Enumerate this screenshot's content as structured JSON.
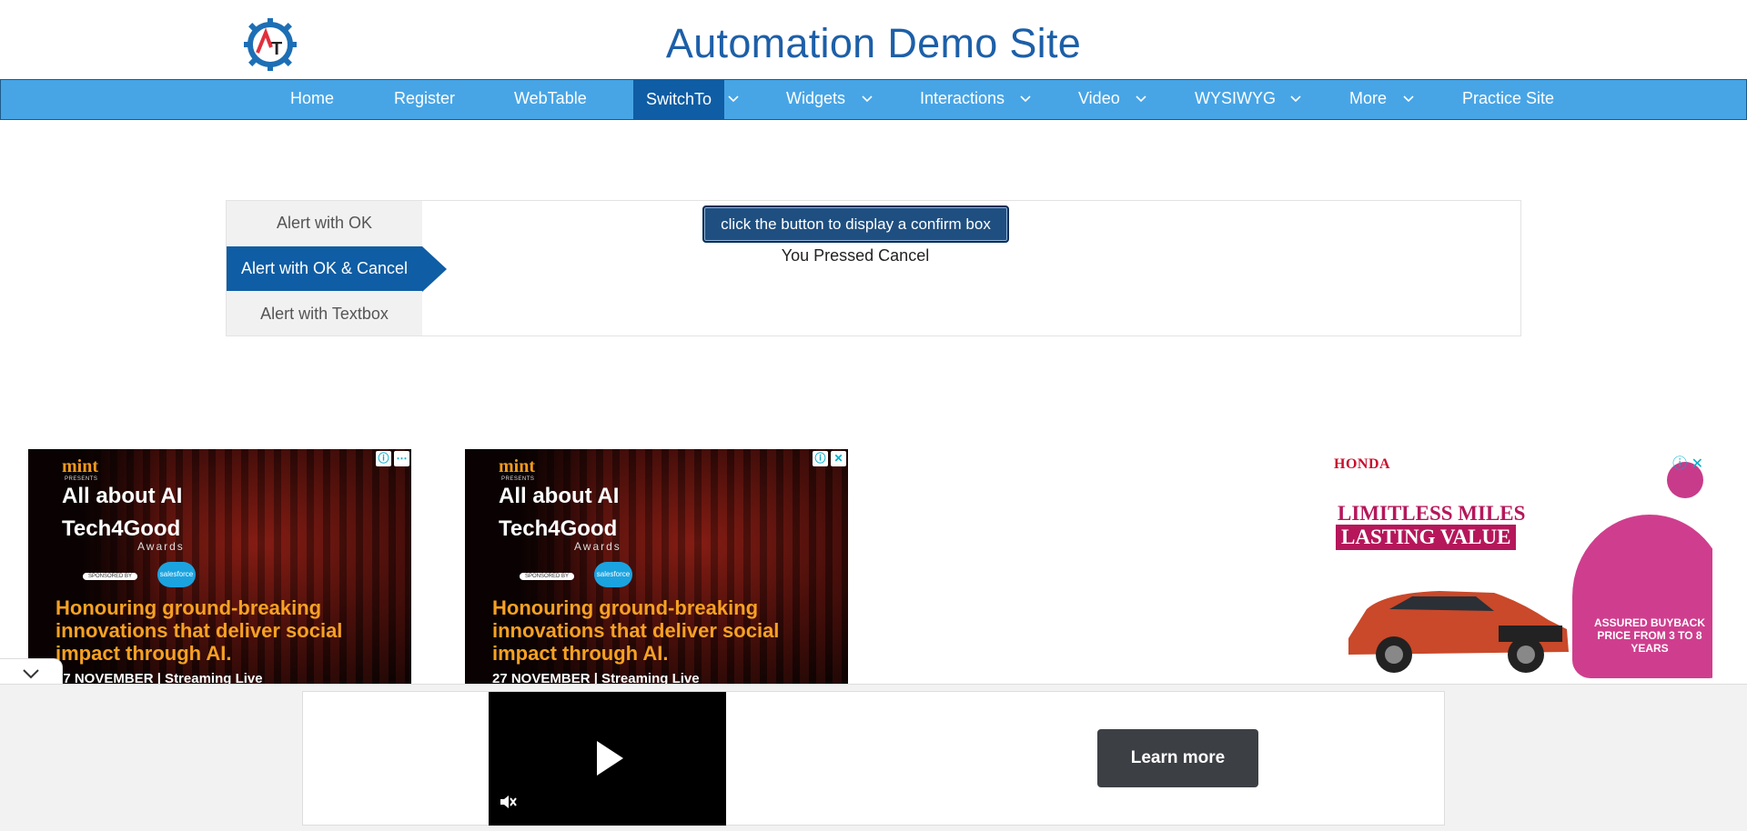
{
  "header": {
    "title": "Automation Demo Site",
    "logo_text": "AT"
  },
  "nav": {
    "items": [
      {
        "label": "Home"
      },
      {
        "label": "Register"
      },
      {
        "label": "WebTable"
      },
      {
        "label": "SwitchTo",
        "active": true
      },
      {
        "label": "Widgets"
      },
      {
        "label": "Interactions"
      },
      {
        "label": "Video"
      },
      {
        "label": "WYSIWYG"
      },
      {
        "label": "More"
      },
      {
        "label": "Practice Site"
      }
    ]
  },
  "tabs": [
    {
      "label": "Alert with OK"
    },
    {
      "label": "Alert with OK & Cancel",
      "active": true
    },
    {
      "label": "Alert with Textbox"
    }
  ],
  "content": {
    "confirm_button": "click the button to display a confirm box",
    "result": "You Pressed Cancel"
  },
  "ads": {
    "mint": {
      "logo": "mint",
      "presents": "PRESENTS",
      "line1": "All about AI",
      "line2": "Tech4Good",
      "awards": "Awards",
      "sponsored": "SPONSORED BY",
      "sponsor": "salesforce",
      "headline": "Honouring ground-breaking innovations that deliver social impact through AI.",
      "date": "27 NOVEMBER | Streaming Live"
    },
    "honda": {
      "brand": "HONDA",
      "line1": "LIMITLESS MILES",
      "line2": "LASTING VALUE",
      "badge": "ASSURED BUYBACK PRICE FROM 3 TO 8 YEARS"
    },
    "bottom": {
      "cta": "Learn more"
    }
  },
  "colors": {
    "title": "#1d5fa8",
    "nav": "#47a5e6",
    "active": "#0f5da4"
  }
}
